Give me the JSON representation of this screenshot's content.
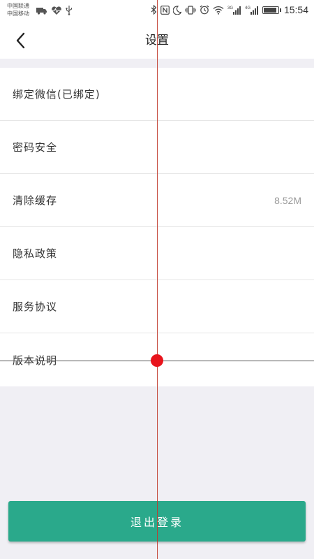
{
  "statusbar": {
    "carrier1": "中国联通",
    "carrier2": "中国移动",
    "left_icons": [
      "truck-icon",
      "heartbeat-icon",
      "usb-icon"
    ],
    "right_icons": [
      "bluetooth-icon",
      "nfc-icon",
      "moon-icon",
      "vibrate-icon",
      "alarm-icon",
      "wifi-icon",
      "signal-3g-icon",
      "signal-4g-icon",
      "battery-icon"
    ],
    "net1": "3G",
    "net2": "4G",
    "battery_level": 0.9,
    "time": "15:54"
  },
  "navbar": {
    "back_icon": "chevron-left-icon",
    "title": "设置"
  },
  "settings": {
    "items": [
      {
        "label": "绑定微信(已绑定)",
        "value": ""
      },
      {
        "label": "密码安全",
        "value": ""
      },
      {
        "label": "清除缓存",
        "value": "8.52M"
      },
      {
        "label": "隐私政策",
        "value": ""
      },
      {
        "label": "服务协议",
        "value": ""
      },
      {
        "label": "版本说明",
        "value": ""
      }
    ]
  },
  "logout": {
    "label": "退出登录",
    "color": "#2aa98b"
  },
  "colors": {
    "accent": "#2aa98b",
    "background": "#f0eff4",
    "marker": "#e8141c"
  }
}
